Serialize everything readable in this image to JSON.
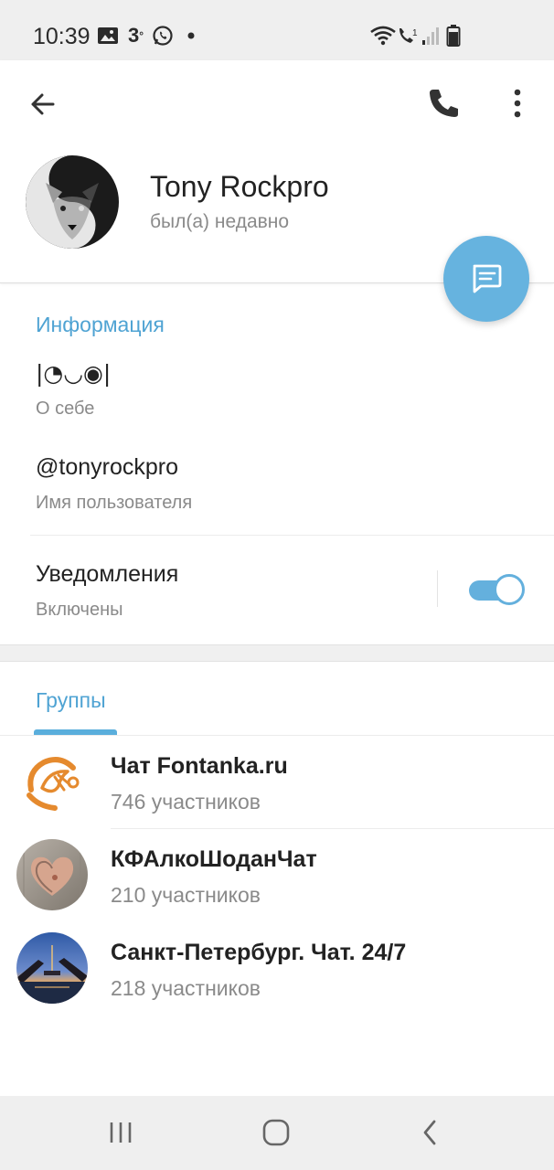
{
  "status_bar": {
    "time": "10:39",
    "icons": [
      "image-icon",
      "3-degrees-icon",
      "whatsapp-icon",
      "dot-icon",
      "wifi-icon",
      "volte-call-icon",
      "signal-icon",
      "battery-icon"
    ]
  },
  "header": {
    "name": "Tony Rockpro",
    "status": "был(а) недавно",
    "icons": [
      "back-arrow-icon",
      "phone-icon",
      "more-vert-icon",
      "message-icon"
    ]
  },
  "info": {
    "section_title": "Информация",
    "bio_value": "|◔◡◉|",
    "bio_label": "О себе",
    "username_value": "@tonyrockpro",
    "username_label": "Имя пользователя",
    "notifications_label": "Уведомления",
    "notifications_status": "Включены",
    "notifications_enabled": true
  },
  "groups": {
    "tab_label": "Группы",
    "items": [
      {
        "name": "Чат Fontanka.ru",
        "members": "746 участников"
      },
      {
        "name": "КФАлкоШоданЧат",
        "members": "210 участников"
      },
      {
        "name": "Санкт-Петербург. Чат. 24/7",
        "members": "218 участников"
      }
    ]
  },
  "nav": [
    "recents-icon",
    "home-icon",
    "back-icon"
  ],
  "colors": {
    "accent": "#4fa3d3",
    "fab": "#66b3df",
    "toggle": "#64b0dd",
    "fontanka_orange": "#e58a2e"
  }
}
